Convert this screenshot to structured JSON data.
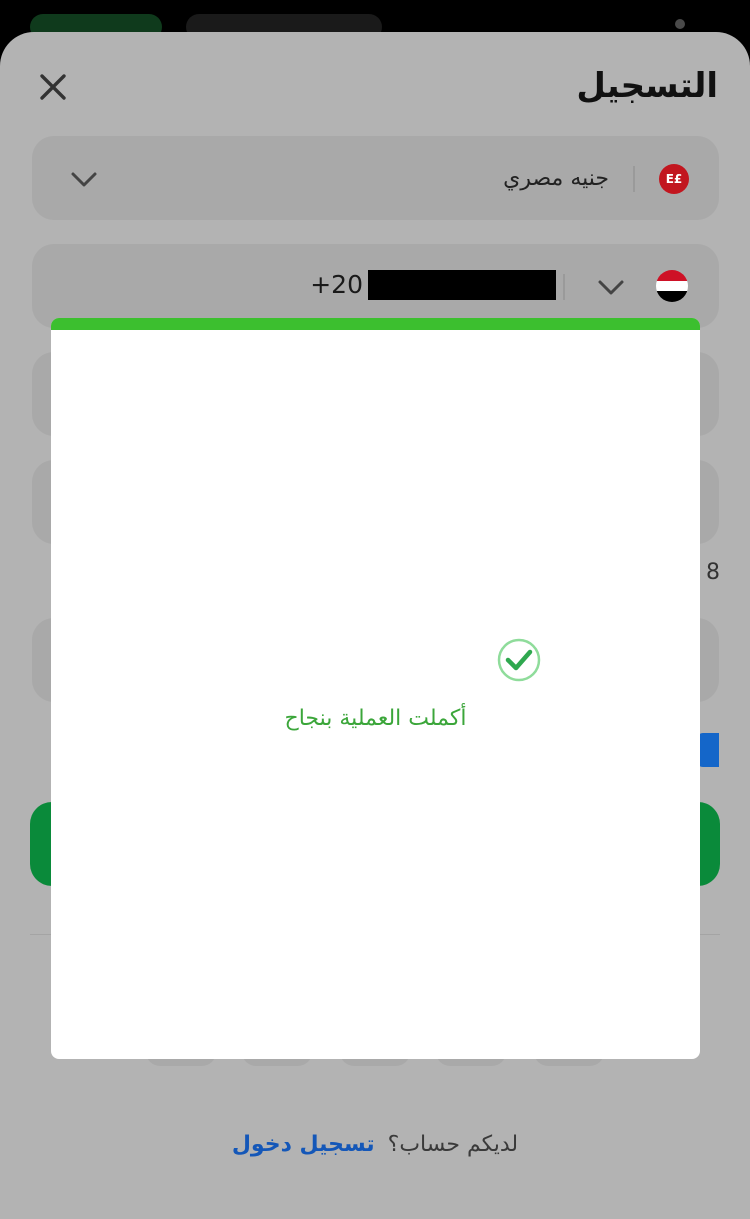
{
  "header": {
    "title": "التسجيل"
  },
  "currency": {
    "symbol": "E£",
    "label": "جنيه مصري"
  },
  "phone": {
    "prefix": "+20"
  },
  "side_digit": "8",
  "modal": {
    "message": "أكملت العملية بنجاح"
  },
  "footer": {
    "question": "لديكم حساب؟",
    "login_link": "تسجيل دخول"
  },
  "colors": {
    "accent_green": "#3cbf2f",
    "link_blue": "#1457b8",
    "primary_button": "#0a8a3a"
  }
}
